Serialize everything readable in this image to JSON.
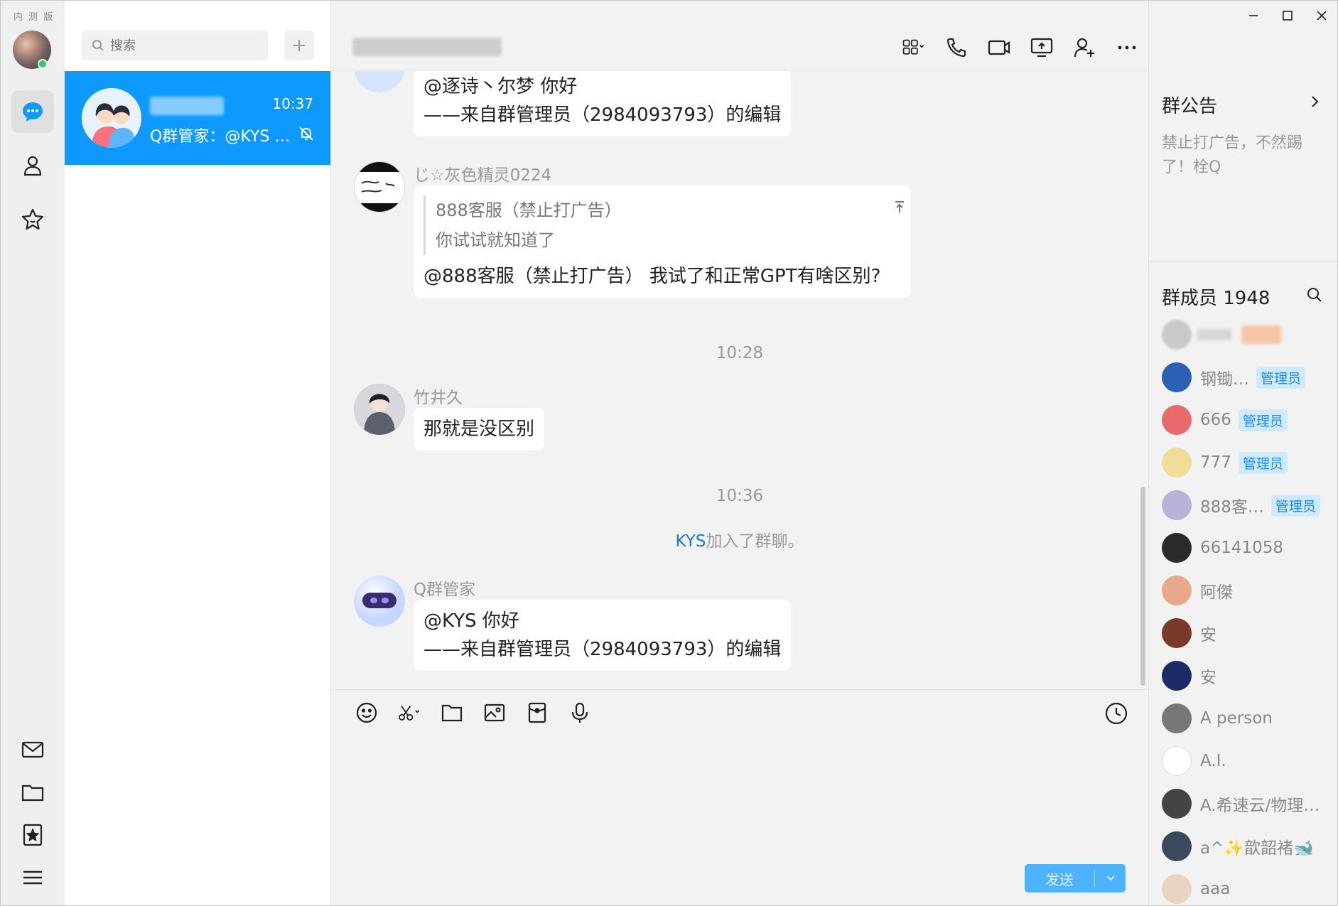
{
  "app": {
    "beta_label": "内 测 版"
  },
  "nav": {
    "items": [
      {
        "name": "messages",
        "active": true
      },
      {
        "name": "contacts",
        "active": false
      },
      {
        "name": "favorites",
        "active": false
      }
    ],
    "bottom": [
      "mail",
      "folder",
      "bookmark",
      "menu"
    ]
  },
  "conversations": {
    "search_placeholder": "搜索",
    "items": [
      {
        "time": "10:37",
        "preview": "Q群管家：@KYS 你好",
        "muted": true,
        "selected": true
      }
    ]
  },
  "chat": {
    "messages": [
      {
        "id": "m0",
        "sender": "",
        "lines": [
          "@逐诗丶尔梦 你好",
          "——来自群管理员（2984093793）的编辑"
        ]
      },
      {
        "id": "m1",
        "sender": "じ☆灰色精灵0224",
        "quote_author": "888客服（禁止打广告）",
        "quote_text": "你试试就知道了",
        "text": "@888客服（禁止打广告） 我试了和正常GPT有啥区别?"
      },
      {
        "id": "t1",
        "timestamp": "10:28"
      },
      {
        "id": "m2",
        "sender": "竹井久",
        "text": "那就是没区别"
      },
      {
        "id": "t2",
        "timestamp": "10:36"
      },
      {
        "id": "s1",
        "system_link": "KYS",
        "system_text": "加入了群聊。"
      },
      {
        "id": "m3",
        "sender": "Q群管家",
        "lines": [
          "@KYS 你好",
          "——来自群管理员（2984093793）的编辑"
        ]
      }
    ],
    "send_label": "发送"
  },
  "side": {
    "notice_title": "群公告",
    "notice_text": "禁止打广告，不然踢了！栓Q",
    "members_title": "群成员 1948",
    "members": [
      {
        "name": "",
        "badge": "",
        "color": "#c9c9c9"
      },
      {
        "name": "钢锄…",
        "badge": "管理员",
        "color": "#2d5fb5"
      },
      {
        "name": "666",
        "badge": "管理员",
        "color": "#e86a6a"
      },
      {
        "name": "777",
        "badge": "管理员",
        "color": "#f2dc9a"
      },
      {
        "name": "888客…",
        "badge": "管理员",
        "color": "#b9b2d8"
      },
      {
        "name": "66141058",
        "badge": "",
        "color": "#2a2a2a"
      },
      {
        "name": "阿傑",
        "badge": "",
        "color": "#e6a98a"
      },
      {
        "name": "安",
        "badge": "",
        "color": "#7a3a2a"
      },
      {
        "name": "安",
        "badge": "",
        "color": "#1a2b66"
      },
      {
        "name": "A person",
        "badge": "",
        "color": "#777777"
      },
      {
        "name": "A.I.",
        "badge": "",
        "color": "#ffffff"
      },
      {
        "name": "A.希速云/物理…",
        "badge": "",
        "color": "#444444"
      },
      {
        "name": "a^✨歆韶褚🐋",
        "badge": "",
        "color": "#3b4a5a"
      },
      {
        "name": "aaa",
        "badge": "",
        "color": "#e8d4c0"
      }
    ]
  }
}
